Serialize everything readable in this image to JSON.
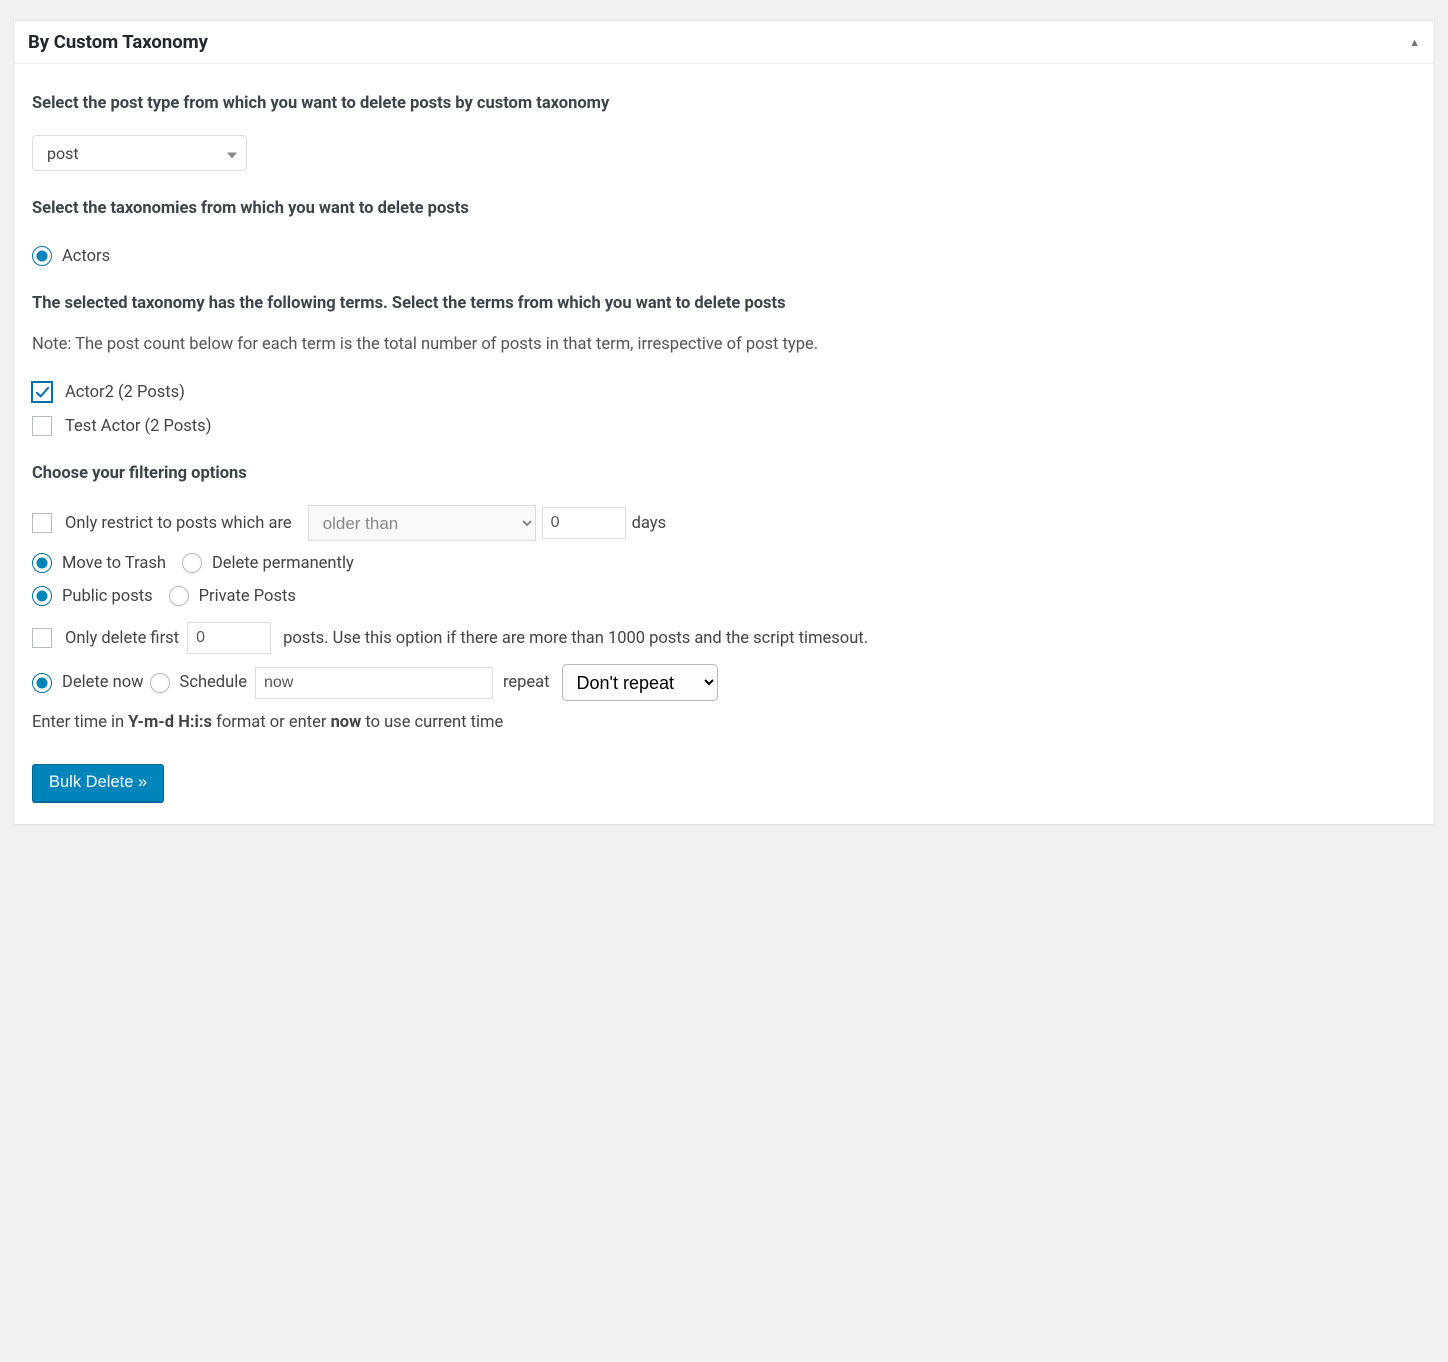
{
  "header": {
    "title": "By Custom Taxonomy"
  },
  "postType": {
    "label": "Select the post type from which you want to delete posts by custom taxonomy",
    "value": "post"
  },
  "taxonomy": {
    "label": "Select the taxonomies from which you want to delete posts",
    "items": [
      {
        "label": "Actors",
        "checked": true
      }
    ]
  },
  "terms": {
    "label": "The selected taxonomy has the following terms. Select the terms from which you want to delete posts",
    "note": "Note: The post count below for each term is the total number of posts in that term, irrespective of post type.",
    "items": [
      {
        "label": "Actor2 (2 Posts)",
        "checked": true
      },
      {
        "label": "Test Actor (2 Posts)",
        "checked": false
      }
    ]
  },
  "filters": {
    "label": "Choose your filtering options",
    "restrict": {
      "label": "Only restrict to posts which are",
      "selectValue": "older than",
      "daysValue": "0",
      "daysLabel": "days"
    },
    "deleteMode": {
      "trash": "Move to Trash",
      "permanent": "Delete permanently"
    },
    "visibility": {
      "public": "Public posts",
      "private": "Private Posts"
    },
    "limit": {
      "prefix": "Only delete first",
      "value": "0",
      "suffix": "posts. Use this option if there are more than 1000 posts and the script timesout."
    },
    "schedule": {
      "now": "Delete now",
      "schedule": "Schedule",
      "timeValue": "now",
      "repeatLabel": "repeat",
      "repeatValue": "Don't repeat"
    },
    "timeNotePrefix": "Enter time in ",
    "timeNoteFormat": "Y-m-d H:i:s",
    "timeNoteMid": " format or enter ",
    "timeNoteNow": "now",
    "timeNoteSuffix": " to use current time"
  },
  "submit": {
    "label": "Bulk Delete »"
  }
}
